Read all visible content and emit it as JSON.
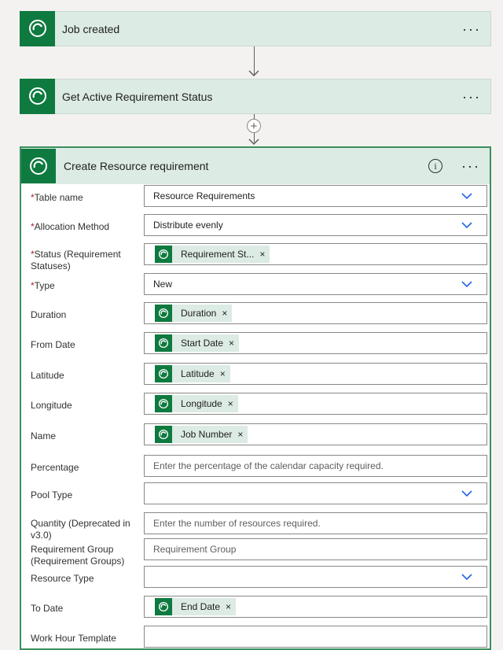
{
  "steps": [
    {
      "title": "Job created",
      "more": "···"
    },
    {
      "title": "Get Active Requirement Status",
      "more": "···"
    }
  ],
  "add_step": "+",
  "card": {
    "title": "Create Resource requirement",
    "info": "i",
    "more": "···",
    "fields": [
      {
        "label": "Table name",
        "required": true,
        "kind": "select",
        "value": "Resource Requirements"
      },
      {
        "label": "Allocation Method",
        "required": true,
        "kind": "select",
        "value": "Distribute evenly"
      },
      {
        "label": "Status (Requirement Statuses)",
        "required": true,
        "kind": "token",
        "token": "Requirement St..."
      },
      {
        "label": "Type",
        "required": true,
        "kind": "select",
        "value": "New"
      },
      {
        "label": "Duration",
        "required": false,
        "kind": "token",
        "token": "Duration"
      },
      {
        "label": "From Date",
        "required": false,
        "kind": "token",
        "token": "Start Date"
      },
      {
        "label": "Latitude",
        "required": false,
        "kind": "token",
        "token": "Latitude"
      },
      {
        "label": "Longitude",
        "required": false,
        "kind": "token",
        "token": "Longitude"
      },
      {
        "label": "Name",
        "required": false,
        "kind": "token",
        "token": "Job Number"
      },
      {
        "label": "Percentage",
        "required": false,
        "kind": "placeholder",
        "placeholder": "Enter the percentage of the calendar capacity required."
      },
      {
        "label": "Pool Type",
        "required": false,
        "kind": "select",
        "value": ""
      },
      {
        "label": "Quantity (Deprecated in v3.0)",
        "required": false,
        "kind": "placeholder",
        "placeholder": "Enter the number of resources required."
      },
      {
        "label": "Requirement Group (Requirement Groups)",
        "required": false,
        "kind": "placeholder",
        "placeholder": "Requirement Group"
      },
      {
        "label": "Resource Type",
        "required": false,
        "kind": "select",
        "value": ""
      },
      {
        "label": "To Date",
        "required": false,
        "kind": "token",
        "token": "End Date"
      },
      {
        "label": "Work Hour Template",
        "required": false,
        "kind": "placeholder",
        "placeholder": ""
      }
    ]
  },
  "colors": {
    "brand": "#0f7a3f",
    "step_bg": "#dcebe4",
    "required": "#a4262c",
    "chevron": "#2266e3"
  },
  "icons": {
    "connector_logo": "dataverse-logo-icon",
    "chevron": "chevron-down-icon",
    "remove": "close-icon",
    "info": "info-icon"
  }
}
